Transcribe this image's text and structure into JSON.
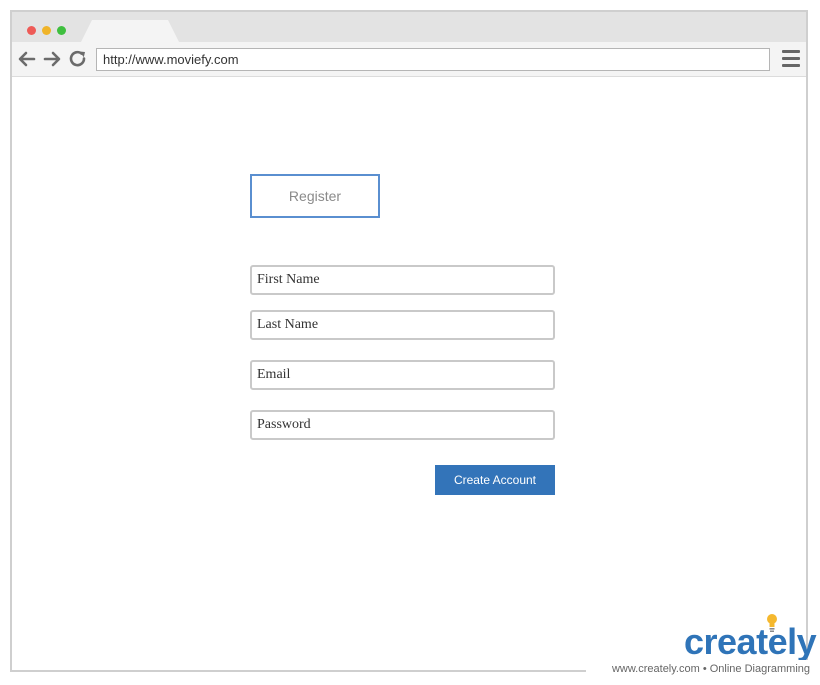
{
  "browser": {
    "url": "http://www.moviefy.com"
  },
  "form": {
    "register_label": "Register",
    "first_name_placeholder": "First Name",
    "last_name_placeholder": "Last Name",
    "email_placeholder": "Email",
    "password_placeholder": "Password",
    "create_account_label": "Create Account"
  },
  "branding": {
    "logo_text": "creately",
    "footer_text": "www.creately.com • Online Diagramming"
  },
  "colors": {
    "accent": "#3374b9",
    "register_border": "#5a8fd0",
    "logo": "#2f74b8",
    "bulb": "#f5b82e"
  }
}
